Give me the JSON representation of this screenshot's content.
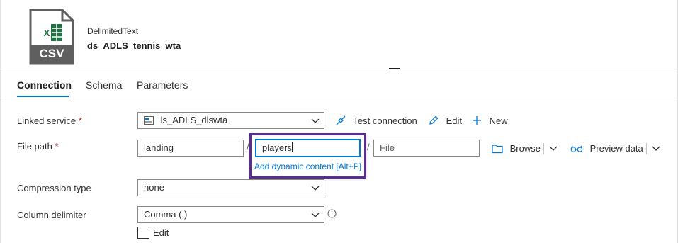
{
  "header": {
    "file_icon_text": "CSV",
    "dataset_type": "DelimitedText",
    "dataset_name": "ds_ADLS_tennis_wta"
  },
  "tabs": [
    {
      "label": "Connection",
      "active": true
    },
    {
      "label": "Schema",
      "active": false
    },
    {
      "label": "Parameters",
      "active": false
    }
  ],
  "linked_service": {
    "label": "Linked service",
    "required_mark": "*",
    "value": "ls_ADLS_dlswta",
    "test_connection_label": "Test connection",
    "edit_label": "Edit",
    "new_label": "New"
  },
  "file_path": {
    "label": "File path",
    "required_mark": "*",
    "container": "landing",
    "separator1": "/",
    "directory": "players",
    "separator2": "/",
    "file_placeholder": "File",
    "dynamic_content_link": "Add dynamic content [Alt+P]",
    "browse_label": "Browse",
    "preview_label": "Preview data"
  },
  "compression": {
    "label": "Compression type",
    "value": "none"
  },
  "column_delimiter": {
    "label": "Column delimiter",
    "value": "Comma (,)",
    "edit_checkbox_label": "Edit",
    "edit_checked": false
  },
  "colors": {
    "accent": "#0078d4",
    "focus_border": "#5c2d91",
    "excel_green": "#217346",
    "required": "#a4262c"
  }
}
